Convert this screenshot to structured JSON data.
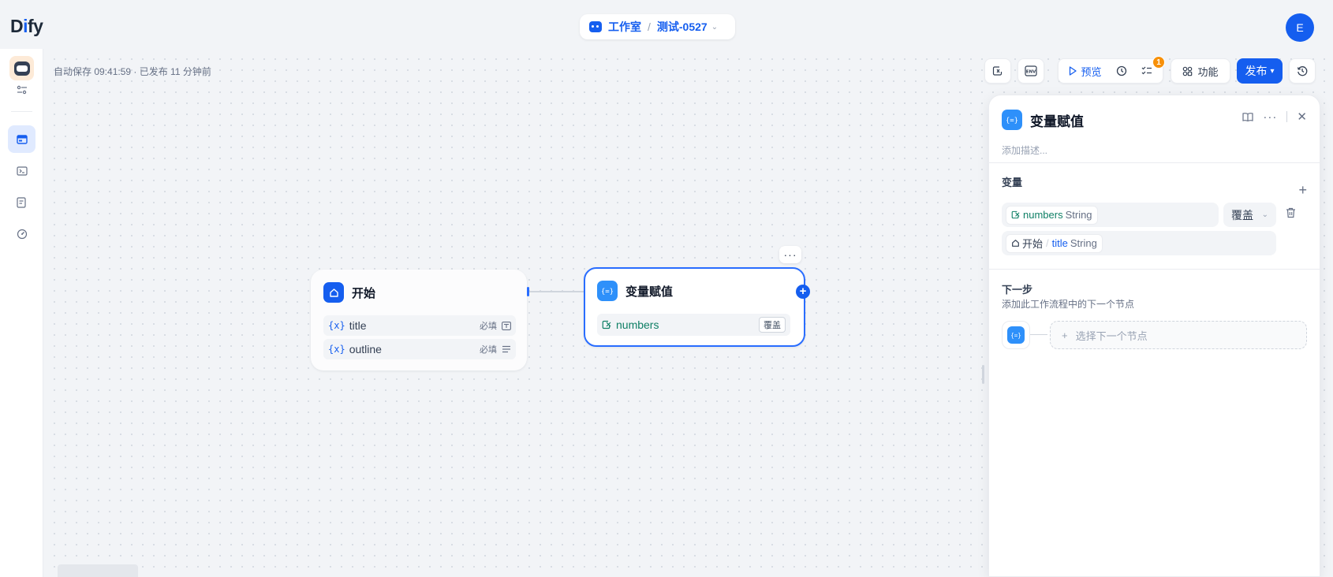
{
  "header": {
    "logo_text_a": "D",
    "logo_text_b": "i",
    "logo_text_c": "fy",
    "workspace_label": "工作室",
    "app_name": "测试-0527",
    "avatar_initial": "E"
  },
  "canvas": {
    "autosave_text": "自动保存 09:41:59 · 已发布 11 分钟前"
  },
  "toolbar": {
    "preview_label": "预览",
    "checklist_badge": "1",
    "features_label": "功能",
    "publish_label": "发布"
  },
  "nodes": {
    "start": {
      "title": "开始",
      "vars": [
        {
          "name": "title",
          "required": "必填"
        },
        {
          "name": "outline",
          "required": "必填"
        }
      ]
    },
    "assigner": {
      "title": "变量赋值",
      "var_name": "numbers",
      "op_tag": "覆盖"
    }
  },
  "panel": {
    "title": "变量赋值",
    "description_placeholder": "添加描述...",
    "variables_section": "变量",
    "target_var": "numbers",
    "target_type": "String",
    "operation": "覆盖",
    "value_node": "开始",
    "value_sep": "/",
    "value_var": "title",
    "value_type": "String",
    "next_section": "下一步",
    "next_sub": "添加此工作流程中的下一个节点",
    "next_select": "选择下一个节点"
  },
  "colors": {
    "primary": "#155eef",
    "accent_green": "#0e7f65",
    "badge_orange": "#f79009"
  }
}
